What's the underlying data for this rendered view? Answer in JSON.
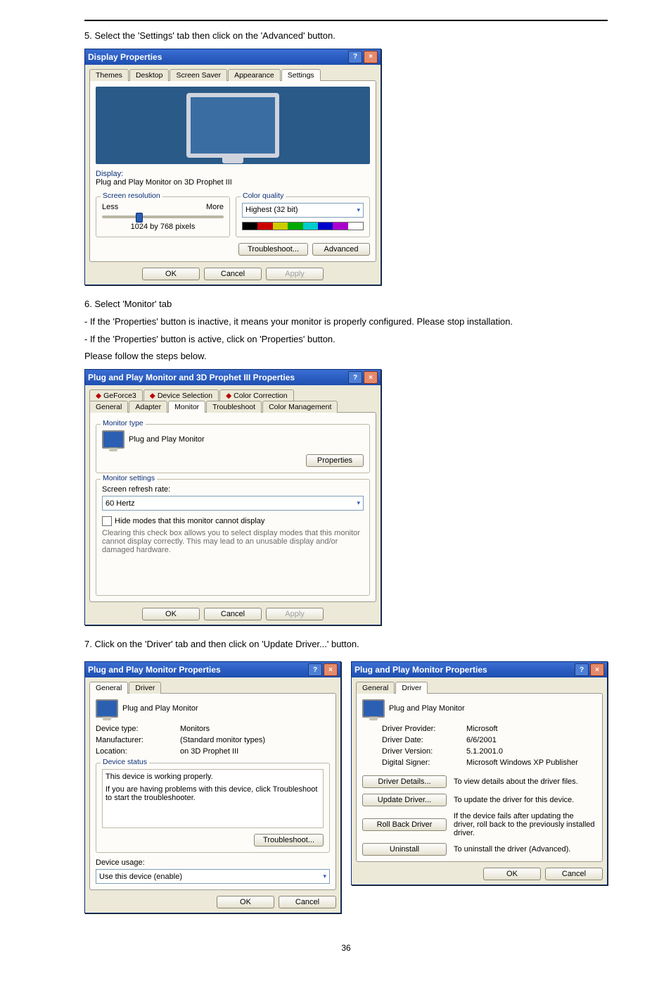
{
  "step5": "5. Select the 'Settings' tab then click on the 'Advanced' button.",
  "dlg1": {
    "title": "Display Properties",
    "tabs": [
      "Themes",
      "Desktop",
      "Screen Saver",
      "Appearance",
      "Settings"
    ],
    "display_label": "Display:",
    "display_value": "Plug and Play Monitor on 3D Prophet III",
    "res_legend": "Screen resolution",
    "res_less": "Less",
    "res_more": "More",
    "res_value": "1024 by 768 pixels",
    "color_legend": "Color quality",
    "color_value": "Highest (32 bit)",
    "troubleshoot": "Troubleshoot...",
    "advanced": "Advanced",
    "ok": "OK",
    "cancel": "Cancel",
    "apply": "Apply"
  },
  "step6": "6. Select 'Monitor' tab",
  "step6a": "- If the 'Properties' button is inactive, it means your monitor is properly configured. Please stop installation.",
  "step6b": "- If the 'Properties' button is active, click on 'Properties' button.",
  "step6c": "Please follow the steps below.",
  "dlg2": {
    "title": "Plug and Play Monitor and 3D Prophet III Properties",
    "tabs_top": [
      "GeForce3",
      "Device Selection",
      "Color Correction"
    ],
    "tabs_bot": [
      "General",
      "Adapter",
      "Monitor",
      "Troubleshoot",
      "Color Management"
    ],
    "type_legend": "Monitor type",
    "type_value": "Plug and Play Monitor",
    "properties": "Properties",
    "settings_legend": "Monitor settings",
    "refresh_label": "Screen refresh rate:",
    "refresh_value": "60 Hertz",
    "hide_label": "Hide modes that this monitor cannot display",
    "hide_text": "Clearing this check box allows you to select display modes that this monitor cannot display correctly. This may lead to an unusable display and/or damaged hardware.",
    "ok": "OK",
    "cancel": "Cancel",
    "apply": "Apply"
  },
  "step7": "7. Click on the 'Driver' tab and then click on 'Update Driver...' button.",
  "dlg3": {
    "title": "Plug and Play Monitor Properties",
    "tabs": [
      "General",
      "Driver"
    ],
    "name": "Plug and Play Monitor",
    "devtype_l": "Device type:",
    "devtype_v": "Monitors",
    "manu_l": "Manufacturer:",
    "manu_v": "(Standard monitor types)",
    "loc_l": "Location:",
    "loc_v": "on 3D Prophet III",
    "status_legend": "Device status",
    "status_text": "This device is working properly.",
    "status_help": "If you are having problems with this device, click Troubleshoot to start the troubleshooter.",
    "troubleshoot": "Troubleshoot...",
    "usage_l": "Device usage:",
    "usage_v": "Use this device (enable)",
    "ok": "OK",
    "cancel": "Cancel"
  },
  "dlg4": {
    "title": "Plug and Play Monitor Properties",
    "tabs": [
      "General",
      "Driver"
    ],
    "name": "Plug and Play Monitor",
    "provider_l": "Driver Provider:",
    "provider_v": "Microsoft",
    "date_l": "Driver Date:",
    "date_v": "6/6/2001",
    "version_l": "Driver Version:",
    "version_v": "5.1.2001.0",
    "signer_l": "Digital Signer:",
    "signer_v": "Microsoft Windows XP Publisher",
    "details_btn": "Driver Details...",
    "details_txt": "To view details about the driver files.",
    "update_btn": "Update Driver...",
    "update_txt": "To update the driver for this device.",
    "rollback_btn": "Roll Back Driver",
    "rollback_txt": "If the device fails after updating the driver, roll back to the previously installed driver.",
    "uninstall_btn": "Uninstall",
    "uninstall_txt": "To uninstall the driver (Advanced).",
    "ok": "OK",
    "cancel": "Cancel"
  },
  "pagenum": "36"
}
